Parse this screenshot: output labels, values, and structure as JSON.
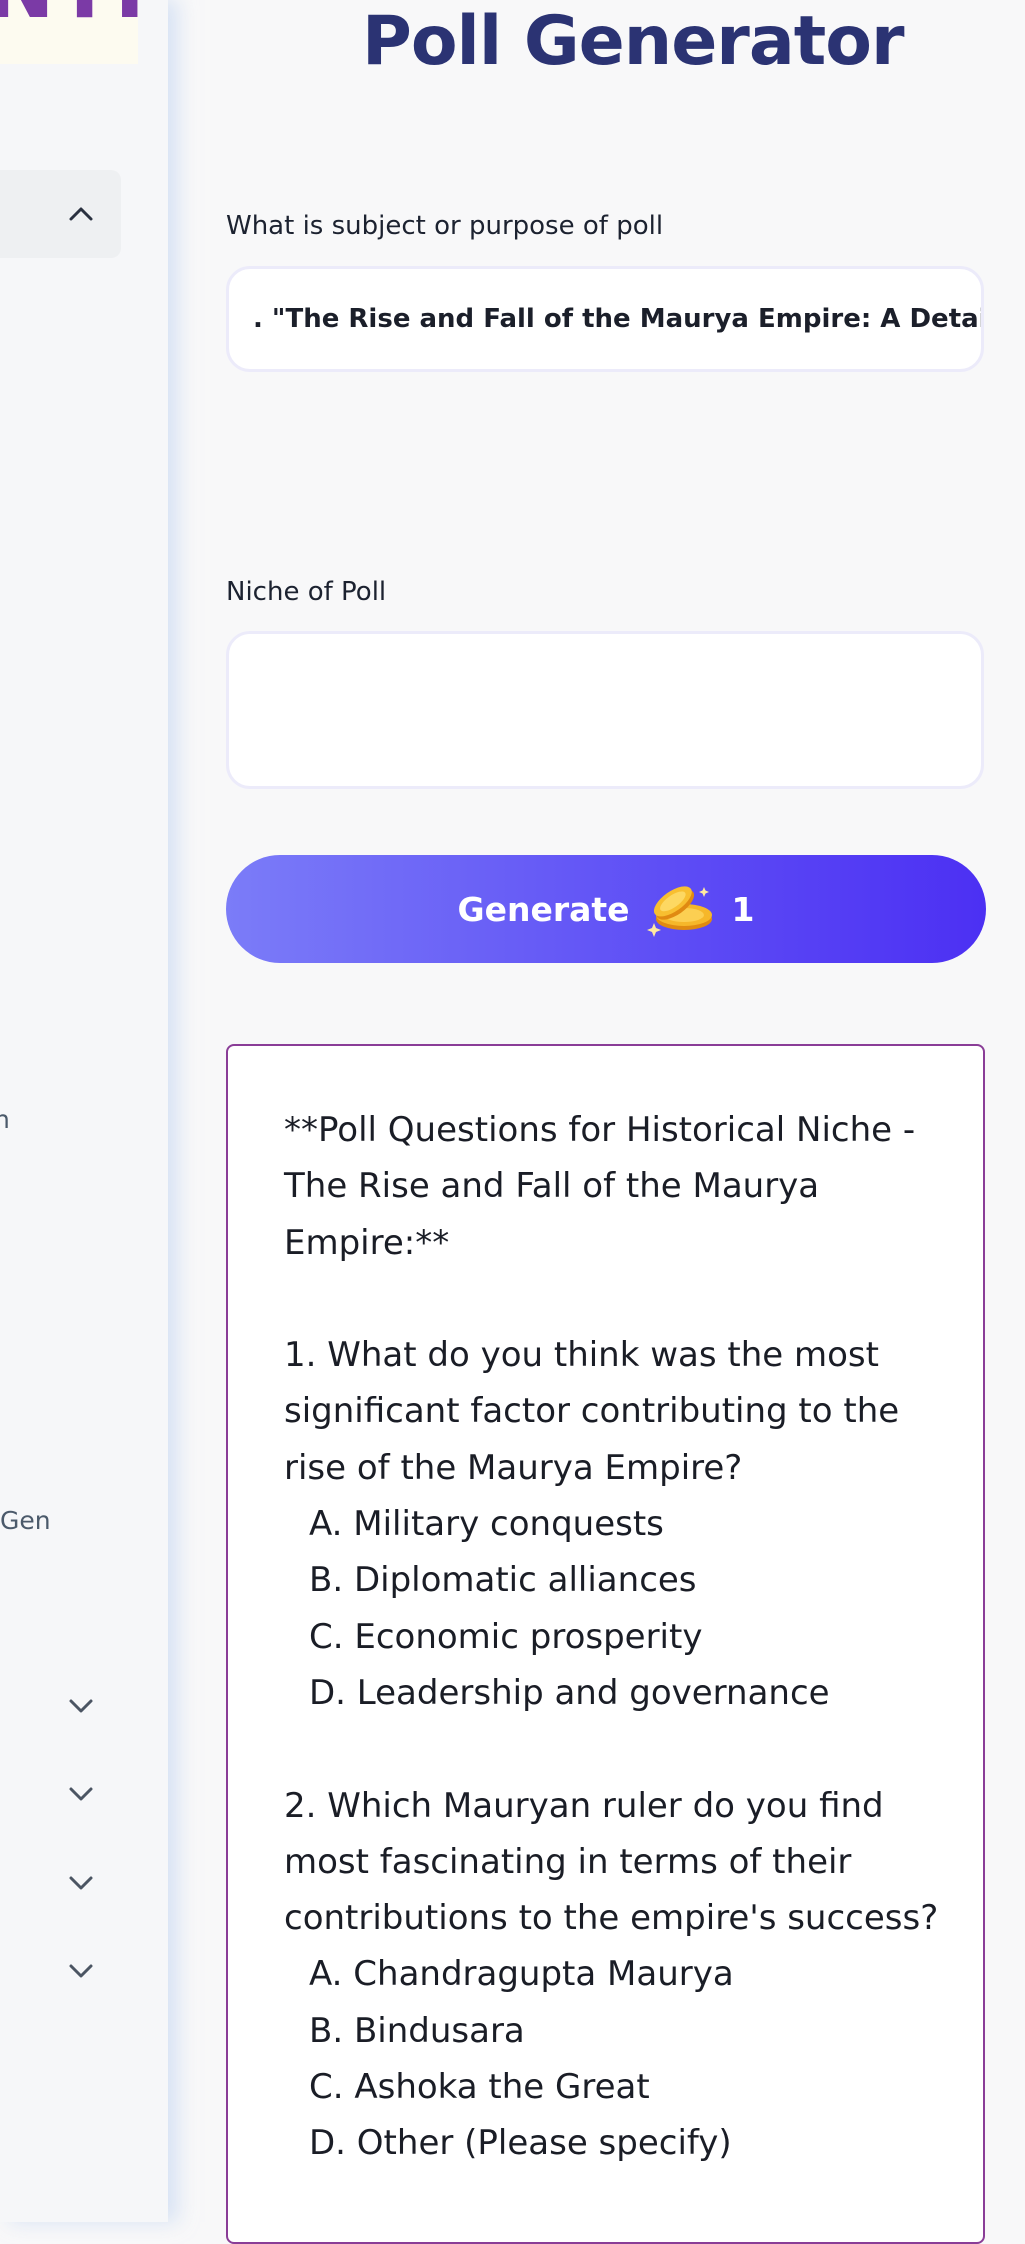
{
  "app": {
    "logo_fragment": "NTI",
    "title": "Poll Generator"
  },
  "sidebar": {
    "fragments": [
      "n",
      "Gen"
    ],
    "chevrons": [
      "chevron-up-icon",
      "chevron-down-icon",
      "chevron-down-icon",
      "chevron-down-icon",
      "chevron-down-icon"
    ]
  },
  "form": {
    "subject_label": "What is subject or purpose of poll",
    "subject_value": ". \"The Rise and Fall of the Maurya Empire: A Detailed",
    "niche_label": "Niche of Poll",
    "niche_value": "",
    "generate_label": "Generate",
    "credit_icon": "coins-icon",
    "credit_cost": "1"
  },
  "output": {
    "lines": [
      "**Poll Questions for Historical Niche -",
      "The Rise and Fall of the Maurya",
      "Empire:**",
      "",
      "1. What do you think was the most",
      "significant factor contributing to the",
      "rise of the Maurya Empire?",
      "A. Military conquests",
      "B. Diplomatic alliances",
      "C. Economic prosperity",
      "D. Leadership and governance",
      "",
      "2. Which Mauryan ruler do you find",
      "most fascinating in terms of their",
      "contributions to the empire's success?",
      "A. Chandragupta Maurya",
      "B. Bindusara",
      "C. Ashoka the Great",
      "D. Other (Please specify)"
    ]
  },
  "colors": {
    "title": "#2b3373",
    "button_start": "#7b7cf8",
    "button_end": "#4c30f3",
    "output_border": "#8a3d97",
    "logo": "#7b3aa6"
  }
}
